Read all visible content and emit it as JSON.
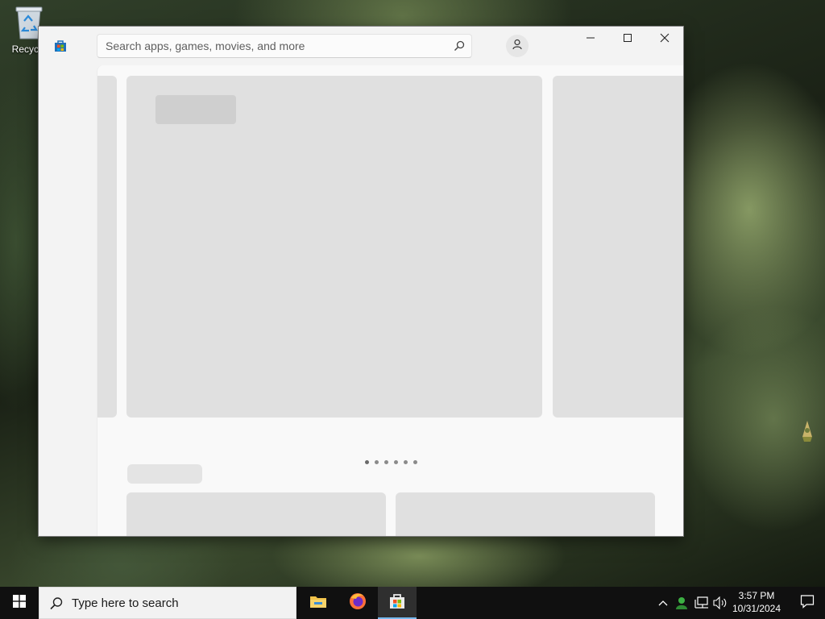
{
  "desktop": {
    "recycle_bin_label": "Recycle"
  },
  "store_window": {
    "search": {
      "placeholder": "Search apps, games, movies, and more"
    },
    "icons": {
      "logo": "microsoft-store-icon",
      "search": "search-icon",
      "account": "user-account-icon"
    },
    "controls": [
      "minimize",
      "maximize",
      "close"
    ],
    "carousel": {
      "page_count": 6,
      "active_index": 0
    },
    "colors": {
      "skeleton": "#e0e0e0",
      "content_bg": "#f9f9f9"
    }
  },
  "taskbar": {
    "search_text": "Type here to search",
    "apps": [
      {
        "name": "file-explorer",
        "active": false
      },
      {
        "name": "firefox",
        "active": false
      },
      {
        "name": "microsoft-store",
        "active": true
      }
    ],
    "clock": {
      "time": "3:57 PM",
      "date": "10/31/2024"
    },
    "accent": "#76b9ed"
  }
}
